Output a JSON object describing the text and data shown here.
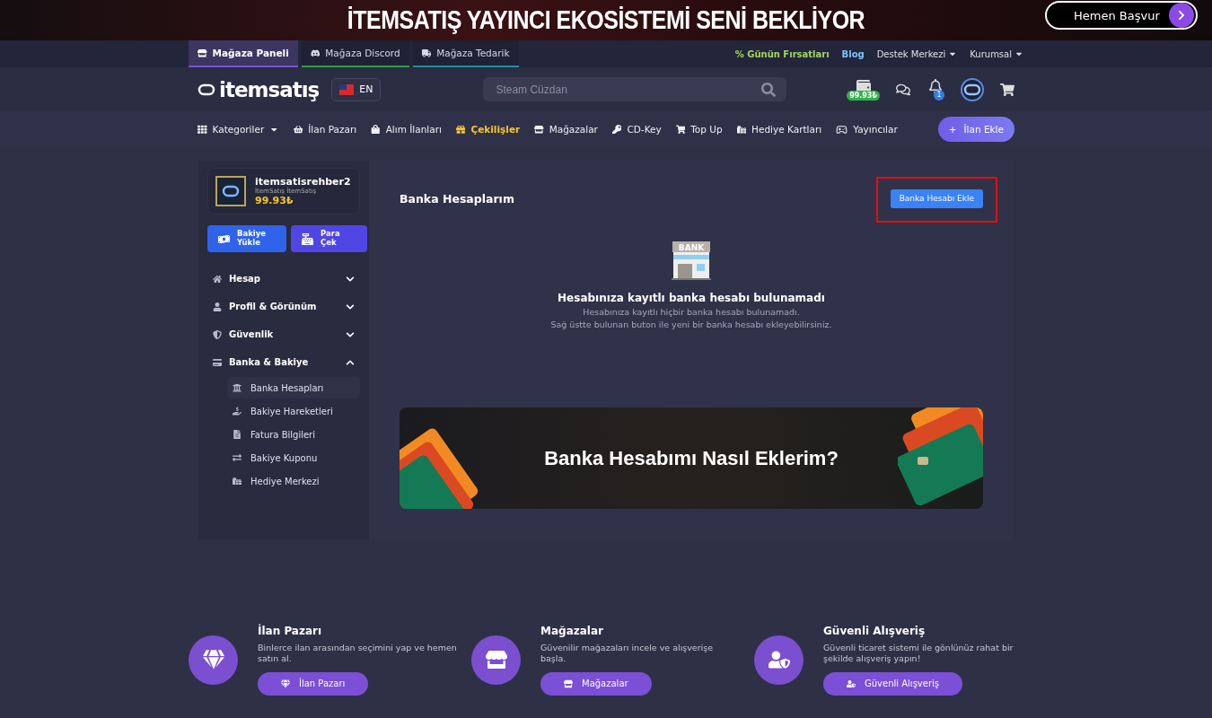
{
  "banner": {
    "title": "İTEMSATIŞ YAYINCI EKOSİSTEMİ SENİ BEKLİYOR",
    "cta": "Hemen Başvur"
  },
  "top_tabs": [
    {
      "label": "Mağaza Paneli",
      "selected": true,
      "color": "#7b4fd6"
    },
    {
      "label": "Mağaza Discord",
      "selected": false,
      "color": "#2f9e48"
    },
    {
      "label": "Mağaza Tedarik",
      "selected": false,
      "color": "#1f8ea0"
    }
  ],
  "top_links": [
    {
      "label": "Günün Fırsatları",
      "kind": "deal",
      "prefix": "%"
    },
    {
      "label": "Blog",
      "kind": "blog"
    },
    {
      "label": "Destek Merkezi",
      "kind": "dropdown"
    },
    {
      "label": "Kurumsal",
      "kind": "dropdown"
    }
  ],
  "header": {
    "logo": "itemsatış",
    "language": "EN",
    "search_placeholder": "Steam Cüzdan",
    "wallet_balance": "99.93₺",
    "notification_count": "1"
  },
  "nav": {
    "items": [
      {
        "label": "Kategoriler",
        "dropdown": true,
        "selected": false
      },
      {
        "label": "İlan Pazarı",
        "dropdown": false,
        "selected": false
      },
      {
        "label": "Alım İlanları",
        "dropdown": false,
        "selected": false
      },
      {
        "label": "Çekilişler",
        "dropdown": false,
        "selected": true
      },
      {
        "label": "Mağazalar",
        "dropdown": false,
        "selected": false
      },
      {
        "label": "CD-Key",
        "dropdown": false,
        "selected": false
      },
      {
        "label": "Top Up",
        "dropdown": false,
        "selected": false
      },
      {
        "label": "Hediye Kartları",
        "dropdown": false,
        "selected": false
      },
      {
        "label": "Yayıncılar",
        "dropdown": false,
        "selected": false
      }
    ],
    "add_button": {
      "symbol": "+",
      "label": "İlan Ekle"
    }
  },
  "sidebar": {
    "profile": {
      "username": "itemsatisrehber2",
      "subtitle": "İtemSatış İtemSatış",
      "balance": "99.93₺"
    },
    "buttons": [
      {
        "label": "Bakiye Yükle",
        "kind": "deposit"
      },
      {
        "label": "Para Çek",
        "kind": "withdraw"
      }
    ],
    "menu": [
      {
        "label": "Hesap",
        "expanded": false
      },
      {
        "label": "Profil & Görünüm",
        "expanded": false
      },
      {
        "label": "Güvenlik",
        "expanded": false
      },
      {
        "label": "Banka & Bakiye",
        "expanded": true,
        "children": [
          {
            "label": "Banka Hesapları",
            "selected": true
          },
          {
            "label": "Bakiye Hareketleri",
            "selected": false
          },
          {
            "label": "Fatura Bilgileri",
            "selected": false
          },
          {
            "label": "Bakiye Kuponu",
            "selected": false
          },
          {
            "label": "Hediye Merkezi",
            "selected": false
          }
        ]
      }
    ]
  },
  "content": {
    "title": "Banka Hesaplarım",
    "add_button": "Banka Hesabı Ekle",
    "empty_title": "Hesabınıza kayıtlı banka hesabı bulunamadı",
    "empty_lines": [
      "Hesabınıza kayıtlı hiçbir banka hesabı bulunamadı.",
      "Sağ üstte bulunan buton ile yeni bir banka hesabı ekleyebilirsiniz."
    ],
    "bank_sign": "BANK",
    "promo_title": "Banka Hesabımı Nasıl Eklerim?"
  },
  "features": [
    {
      "title": "İlan Pazarı",
      "description": "Binlerce ilan arasından seçimini yap ve hemen satın al.",
      "button": "İlan Pazarı",
      "kind": "market"
    },
    {
      "title": "Mağazalar",
      "description": "Güvenilir mağazaları incele ve alışverişe başla.",
      "button": "Mağazalar",
      "kind": "stores"
    },
    {
      "title": "Güvenli Alışveriş",
      "description": "Güvenli ticaret sistemi ile gönlünüz rahat bir şekilde alışveriş yapın!",
      "button": "Güvenli Alışveriş",
      "kind": "secure"
    }
  ]
}
